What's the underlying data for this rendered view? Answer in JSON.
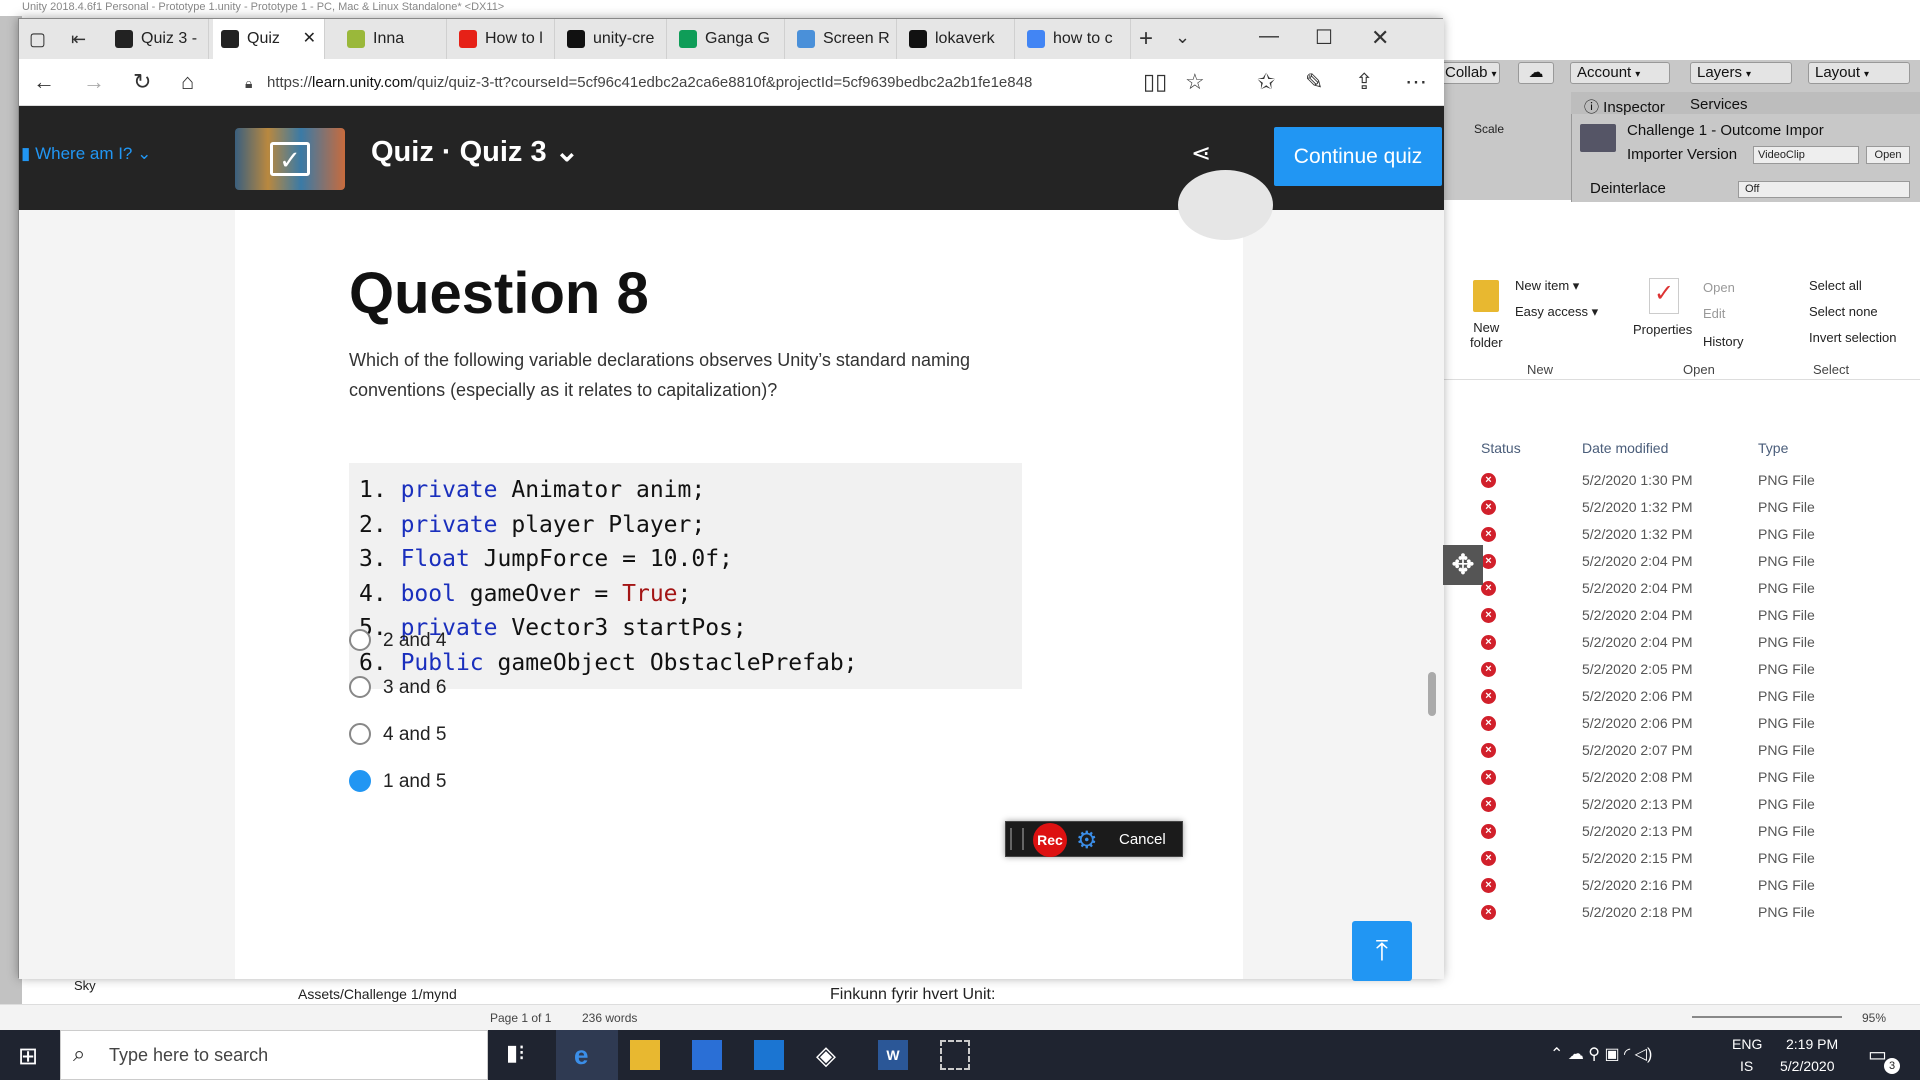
{
  "unity": {
    "title": "Unity 2018.4.6f1 Personal - Prototype 1.unity - Prototype 1 - PC, Mac & Linux Standalone* <DX11>",
    "buttons": {
      "collab": "Collab",
      "account": "Account",
      "layers": "Layers",
      "layout": "Layout"
    },
    "tabs": {
      "inspector": "Inspector",
      "services": "Services"
    },
    "scale_label": "Scale",
    "inspector": {
      "asset_title": "Challenge 1 - Outcome Impor",
      "importer_label": "Importer Version",
      "importer_value": "VideoClip",
      "open_label": "Open",
      "deinterlace_label": "Deinterlace",
      "deinterlace_value": "Off"
    },
    "hierarchy_item": "Sky",
    "project_path": "Assets/Challenge 1/mynd"
  },
  "explorer": {
    "ribbon": {
      "new_item": "New item",
      "easy_access": "Easy access",
      "new_folder": "New\nfolder",
      "properties": "Properties",
      "open": "Open",
      "edit": "Edit",
      "history": "History",
      "select_all": "Select all",
      "select_none": "Select none",
      "invert_selection": "Invert selection",
      "group_new": "New",
      "group_open": "Open",
      "group_select": "Select"
    },
    "columns": {
      "status": "Status",
      "date": "Date modified",
      "type": "Type"
    },
    "files": [
      {
        "date": "5/2/2020 1:30 PM",
        "type": "PNG File"
      },
      {
        "date": "5/2/2020 1:32 PM",
        "type": "PNG File"
      },
      {
        "date": "5/2/2020 1:32 PM",
        "type": "PNG File"
      },
      {
        "date": "5/2/2020 2:04 PM",
        "type": "PNG File"
      },
      {
        "date": "5/2/2020 2:04 PM",
        "type": "PNG File"
      },
      {
        "date": "5/2/2020 2:04 PM",
        "type": "PNG File"
      },
      {
        "date": "5/2/2020 2:04 PM",
        "type": "PNG File"
      },
      {
        "date": "5/2/2020 2:05 PM",
        "type": "PNG File"
      },
      {
        "date": "5/2/2020 2:06 PM",
        "type": "PNG File"
      },
      {
        "date": "5/2/2020 2:06 PM",
        "type": "PNG File"
      },
      {
        "date": "5/2/2020 2:07 PM",
        "type": "PNG File"
      },
      {
        "date": "5/2/2020 2:08 PM",
        "type": "PNG File"
      },
      {
        "date": "5/2/2020 2:13 PM",
        "type": "PNG File"
      },
      {
        "date": "5/2/2020 2:13 PM",
        "type": "PNG File"
      },
      {
        "date": "5/2/2020 2:15 PM",
        "type": "PNG File"
      },
      {
        "date": "5/2/2020 2:16 PM",
        "type": "PNG File"
      },
      {
        "date": "5/2/2020 2:18 PM",
        "type": "PNG File"
      }
    ]
  },
  "word": {
    "doc_text": "Finkunn fyrir hvert Unit:",
    "page": "Page 1 of 1",
    "words": "236 words",
    "zoom": "95%"
  },
  "browser": {
    "tabs": [
      {
        "label": "Quiz 3 -",
        "icon_color": "#222",
        "active": false
      },
      {
        "label": "Quiz",
        "icon_color": "#222",
        "active": true
      },
      {
        "label": "Inna",
        "icon_color": "#9ab83a",
        "active": false
      },
      {
        "label": "How to l",
        "icon_color": "#e62117",
        "active": false
      },
      {
        "label": "unity-cre",
        "icon_color": "#111",
        "active": false
      },
      {
        "label": "Ganga G",
        "icon_color": "#0f9d58",
        "active": false
      },
      {
        "label": "Screen R",
        "icon_color": "#4a90d9",
        "active": false
      },
      {
        "label": "lokaverk",
        "icon_color": "#111",
        "active": false
      },
      {
        "label": "how to c",
        "icon_color": "#4285f4",
        "active": false
      }
    ],
    "url_prefix": "https://",
    "url_domain": "learn.unity.com",
    "url_path": "/quiz/quiz-3-tt?courseId=5cf96c41edbc2a2ca6e8810f&projectId=5cf9639bedbc2a2b1fe1e848"
  },
  "learn": {
    "where_am_i": "Where am I?",
    "quiz_title": "Quiz · Quiz 3",
    "continue_label": "Continue quiz",
    "question_title": "Question 8",
    "question_text": "Which of the following variable declarations observes Unity’s standard naming conventions (especially as it relates to capitalization)?",
    "code_lines": [
      {
        "num": "1.",
        "kw": "private",
        "rest": " Animator anim;"
      },
      {
        "num": "2.",
        "kw": "private",
        "rest": " player Player;"
      },
      {
        "num": "3.",
        "kw": "Float",
        "rest": " JumpForce = 10.0f;"
      },
      {
        "num": "4.",
        "kw": "bool",
        "rest": " gameOver = ",
        "lit": "True",
        "tail": ";"
      },
      {
        "num": "5.",
        "kw": "private",
        "rest": " Vector3 startPos;"
      },
      {
        "num": "6.",
        "kw": "Public",
        "rest": " gameObject ObstaclePrefab;"
      }
    ],
    "options": [
      {
        "label": "2 and 4",
        "selected": false
      },
      {
        "label": "3 and 6",
        "selected": false
      },
      {
        "label": "4 and 5",
        "selected": false
      },
      {
        "label": "1 and 5",
        "selected": true
      }
    ]
  },
  "recorder": {
    "rec": "Rec",
    "cancel": "Cancel"
  },
  "taskbar": {
    "search_placeholder": "Type here to search",
    "lang": "ENG",
    "region": "IS",
    "time": "2:19 PM",
    "date": "5/2/2020",
    "notif_count": "3"
  }
}
